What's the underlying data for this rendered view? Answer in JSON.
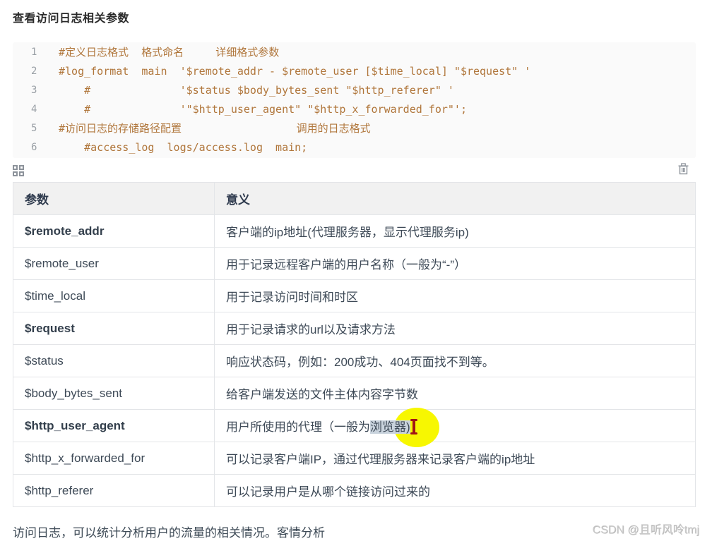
{
  "page": {
    "title": "查看访问日志相关参数",
    "footer_text": "访问日志，可以统计分析用户的流量的相关情况。客情分析",
    "watermark": "CSDN @且听风呤tmj"
  },
  "code_block": {
    "lines": [
      {
        "num": "1",
        "code": "#定义日志格式  格式命名     详细格式参数"
      },
      {
        "num": "2",
        "code": "#log_format  main  '$remote_addr - $remote_user [$time_local] \"$request\" '"
      },
      {
        "num": "3",
        "code": "    #              '$status $body_bytes_sent \"$http_referer\" '"
      },
      {
        "num": "4",
        "code": "    #              '\"$http_user_agent\" \"$http_x_forwarded_for\"';"
      },
      {
        "num": "5",
        "code": "#访问日志的存储路径配置                  调用的日志格式"
      },
      {
        "num": "6",
        "code": "    #access_log  logs/access.log  main;"
      }
    ],
    "icons": {
      "grid_icon": "grid-icon",
      "trash_icon": "trash-icon"
    }
  },
  "table": {
    "headers": [
      "参数",
      "意义"
    ],
    "rows": [
      {
        "param": "$remote_addr",
        "bold": true,
        "meaning": "客户端的ip地址(代理服务器，显示代理服务ip)"
      },
      {
        "param": "$remote_user",
        "bold": false,
        "meaning": "用于记录远程客户端的用户名称（一般为“-”）"
      },
      {
        "param": "$time_local",
        "bold": false,
        "meaning": "用于记录访问时间和时区"
      },
      {
        "param": "$request",
        "bold": true,
        "meaning": "用于记录请求的url以及请求方法"
      },
      {
        "param": "$status",
        "bold": false,
        "meaning": "响应状态码，例如：200成功、404页面找不到等。"
      },
      {
        "param": "$body_bytes_sent",
        "bold": false,
        "meaning": "给客户端发送的文件主体内容字节数"
      },
      {
        "param": "$http_user_agent",
        "bold": true,
        "meaning_parts": {
          "before": "用户所使用的代理（一般为",
          "selected": "浏览器)"
        },
        "annotation": {
          "type": "yellow-circle-with-text-cursor",
          "highlight_color": "#f7f701",
          "cursor_color": "#a01616",
          "selection_color": "#c9d3dd"
        }
      },
      {
        "param": "$http_x_forwarded_for",
        "bold": false,
        "meaning": "可以记录客户端IP，通过代理服务器来记录客户端的ip地址"
      },
      {
        "param": "$http_referer",
        "bold": false,
        "meaning": "可以记录用户是从哪个链接访问过来的"
      }
    ]
  },
  "colors": {
    "code_text": "#b0763b",
    "code_bg": "#fafafa",
    "line_number": "#9aa0a6",
    "table_header_bg": "#f1f1f1",
    "table_border": "#e3e5e8",
    "body_text": "#3e4a57"
  }
}
